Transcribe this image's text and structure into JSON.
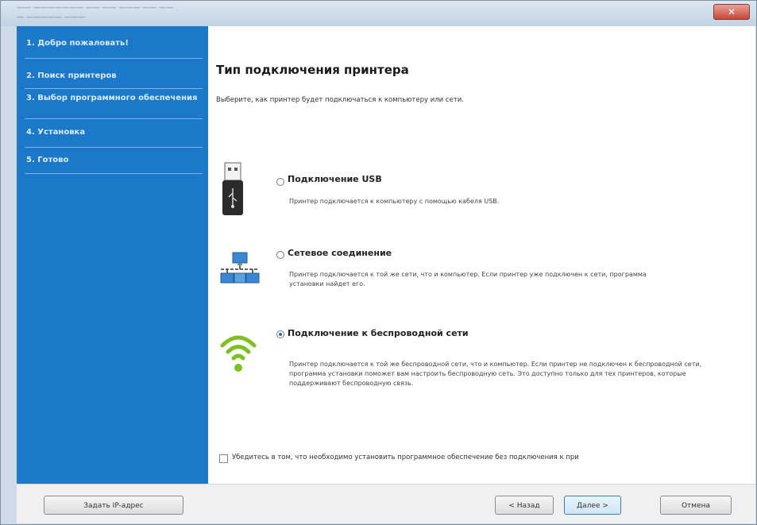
{
  "window": {
    "title_line1": "—— ——————— —— ——    ——— —— ——",
    "title_line2": "— —————    ———",
    "close_glyph": "✕"
  },
  "sidebar": {
    "steps": [
      {
        "label": "1. Добро пожаловать!"
      },
      {
        "label": "2. Поиск принтеров"
      },
      {
        "label": "3. Выбор программного обеспечения"
      },
      {
        "label": "4. Установка"
      },
      {
        "label": "5. Готово"
      }
    ]
  },
  "main": {
    "heading": "Тип подключения принтера",
    "subtitle": "Выберите, как принтер будет подключаться к компьютеру или сети.",
    "options": [
      {
        "title": "Подключение USB",
        "desc": "Принтер подключается к компьютеру с помощью кабеля USB.",
        "selected": false,
        "icon": "usb-icon"
      },
      {
        "title": "Сетевое соединение",
        "desc": "Принтер подключается к той же сети, что и компьютер. Если принтер уже подключен к сети, программа установки найдет его.",
        "selected": false,
        "icon": "network-icon"
      },
      {
        "title": "Подключение к беспроводной сети",
        "desc": "Принтер подключается к той же беспроводной сети, что и компьютер. Если принтер не подключен к беспроводной сети, программа установки поможет вам настроить беспроводную сеть. Это доступно только для тех принтеров, которые поддерживают беспроводную связь.",
        "selected": true,
        "icon": "wifi-icon"
      }
    ],
    "checkbox_label": "Убедитесь в том, что необходимо установить программное обеспечение без подключения к при"
  },
  "footer": {
    "ip_button": "Задать IP-адрес",
    "back_button": "< Назад",
    "next_button": "Далее >",
    "cancel_button": "Отмена"
  },
  "colors": {
    "sidebar": "#1c78c9",
    "accent": "#1f6fbf",
    "wifi": "#7cc21f"
  }
}
